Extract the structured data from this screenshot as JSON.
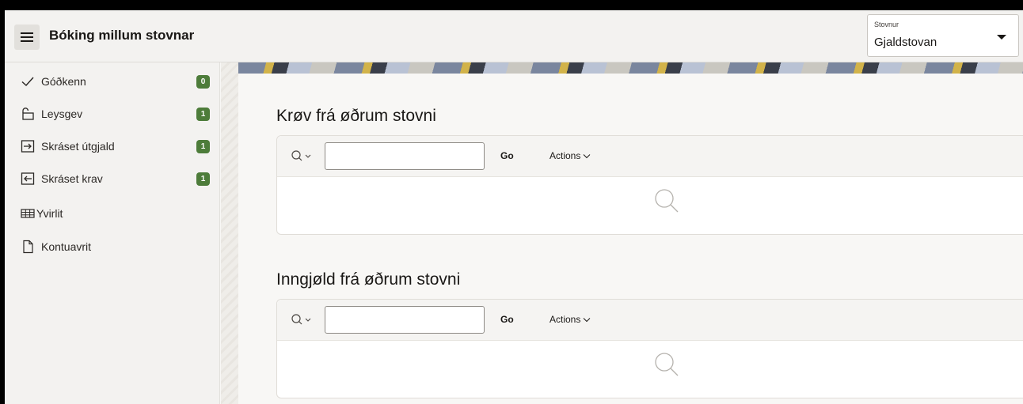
{
  "header": {
    "menu_icon": "hamburger-icon",
    "title": "Bóking millum stovnar",
    "stovnur": {
      "label": "Stovnur",
      "value": "Gjaldstovan"
    }
  },
  "sidebar": {
    "items": [
      {
        "label": "Góðkenn",
        "icon": "check-icon",
        "badge": "0"
      },
      {
        "label": "Leysgev",
        "icon": "unlock-icon",
        "badge": "1"
      },
      {
        "label": "Skráset útgjald",
        "icon": "arrow-right-box-icon",
        "badge": "1"
      },
      {
        "label": "Skráset krav",
        "icon": "arrow-left-box-icon",
        "badge": "1"
      },
      {
        "label": "Yvirlit",
        "icon": "table-icon"
      },
      {
        "label": "Kontuavrit",
        "icon": "document-icon"
      }
    ]
  },
  "regions": [
    {
      "title": "Krøv frá øðrum stovni",
      "search_value": "",
      "go_label": "Go",
      "actions_label": "Actions"
    },
    {
      "title": "Inngjøld frá øðrum stovni",
      "search_value": "",
      "go_label": "Go",
      "actions_label": "Actions"
    }
  ],
  "colors": {
    "badge": "#4d7c3a",
    "header_bg": "#f3f2f0",
    "content_bg": "#f8f7f5"
  }
}
